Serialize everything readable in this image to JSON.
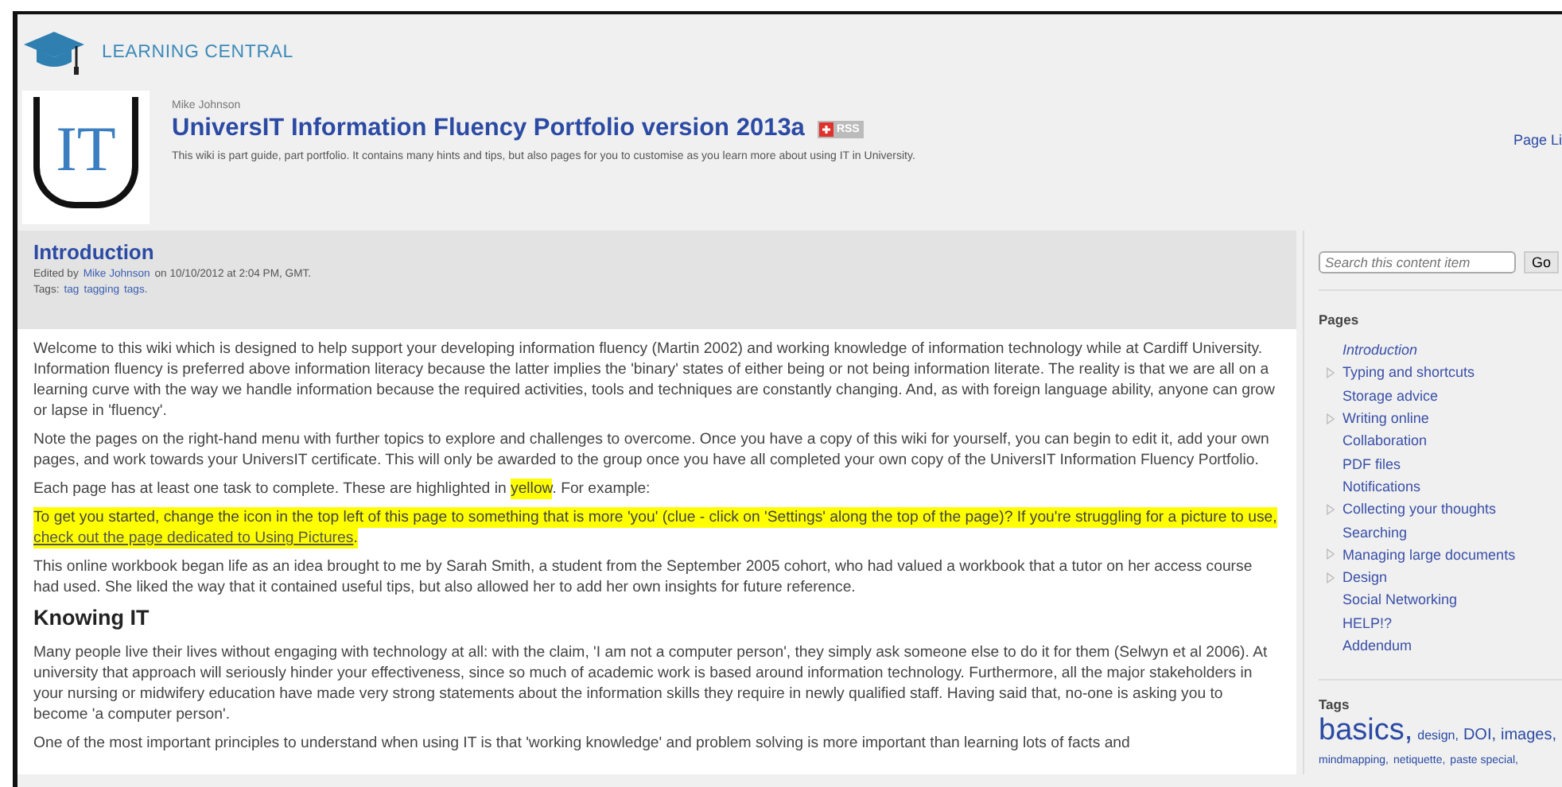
{
  "site": {
    "name": "LEARNING CENTRAL"
  },
  "header": {
    "logo_text": "IT",
    "author": "Mike Johnson",
    "title": "UniversIT Information Fluency Portfolio version 2013a",
    "badge": "RSS",
    "description": "This wiki is part guide, part portfolio. It contains many hints and tips, but also pages for you to customise as you learn more about using IT in University.",
    "page_link": "Page Li"
  },
  "article": {
    "title": "Introduction",
    "edited_prefix": "Edited by",
    "edited_by": "Mike Johnson",
    "edited_suffix": "on 10/10/2012 at 2:04 PM, GMT.",
    "tags_label": "Tags:",
    "tags": [
      "tag",
      "tagging",
      "tags."
    ],
    "blocks": [
      {
        "kind": "para",
        "text": "Welcome to this wiki which is designed to help support your developing information fluency (Martin 2002) and working knowledge of information technology while at Cardiff University. Information fluency is preferred above information literacy because the latter implies the 'binary' states of either being or not being information literate. The reality is that we are all on a learning curve with the way we handle information because the required activities, tools and techniques are constantly changing. And, as with foreign language ability, anyone can grow or lapse in 'fluency'."
      },
      {
        "kind": "para",
        "text": "Note the pages on the right-hand menu with further topics to explore and challenges to overcome. Once you have a copy of this wiki for yourself, you can begin to edit it, add your own pages, and work towards your UniversIT certificate. This will only be awarded to the group once you have all completed your own copy of the UniversIT Information Fluency Portfolio."
      },
      {
        "kind": "mark",
        "before": "Each page has at least one task to complete. These are highlighted in ",
        "marked": "yellow",
        "after": ". For example:"
      },
      {
        "kind": "task",
        "text": "To get you started, change the icon in the top left of this page to something that is more 'you' (clue - click on 'Settings' along the top of the page)? If you're struggling for a picture to use, ",
        "link": "check out the page dedicated to Using Pictures",
        "after": "."
      },
      {
        "kind": "para",
        "text": "This online workbook began life as an idea brought to me by Sarah Smith, a student from the September 2005 cohort, who had valued a workbook that a tutor on her access course had used. She liked the way that it contained useful tips, but also allowed her to add her own insights for future reference."
      },
      {
        "kind": "heading",
        "text": "Knowing IT"
      },
      {
        "kind": "para",
        "text": "Many people live their lives without engaging with technology at all: with the claim, 'I am not a computer person', they simply ask someone else to do it for them (Selwyn et al 2006). At university that approach will seriously hinder your effectiveness, since so much of academic work is based around information technology. Furthermore, all the major stakeholders in your nursing or midwifery education have made very strong statements about the information skills they require in newly qualified staff. Having said that, no-one is asking you to become 'a computer person'."
      },
      {
        "kind": "para",
        "text": "One of the most important principles to understand when using IT is that 'working knowledge' and problem solving is more important than learning lots of facts and"
      }
    ]
  },
  "sidebar": {
    "search": {
      "placeholder": "Search this content item",
      "button": "Go"
    },
    "pages_title": "Pages",
    "pages": [
      {
        "label": "Introduction",
        "kind": "leaf",
        "selected": true
      },
      {
        "label": "Typing and shortcuts",
        "kind": "branch",
        "selected": false
      },
      {
        "label": "Storage advice",
        "kind": "leaf",
        "selected": false
      },
      {
        "label": "Writing online",
        "kind": "branch",
        "selected": false
      },
      {
        "label": "Collaboration",
        "kind": "leaf",
        "selected": false
      },
      {
        "label": "PDF files",
        "kind": "leaf",
        "selected": false
      },
      {
        "label": "Notifications",
        "kind": "leaf",
        "selected": false
      },
      {
        "label": "Collecting your thoughts",
        "kind": "branch",
        "selected": false
      },
      {
        "label": "Searching",
        "kind": "leaf",
        "selected": false
      },
      {
        "label": "Managing large documents",
        "kind": "branch",
        "selected": false
      },
      {
        "label": "Design",
        "kind": "branch",
        "selected": false
      },
      {
        "label": "Social Networking",
        "kind": "leaf",
        "selected": false
      },
      {
        "label": "HELP!?",
        "kind": "leaf",
        "selected": false
      },
      {
        "label": "Addendum",
        "kind": "leaf",
        "selected": false
      }
    ],
    "tags_title": "Tags",
    "tags": [
      {
        "label": "basics,",
        "kind": "large"
      },
      {
        "label": "design,",
        "kind": "small"
      },
      {
        "label": "DOI,",
        "kind": "medium"
      },
      {
        "label": "images,",
        "kind": "medium"
      },
      {
        "label": "mindmapping,",
        "kind": "tiny"
      },
      {
        "label": "netiquette,",
        "kind": "tiny"
      },
      {
        "label": "paste special,",
        "kind": "tiny"
      }
    ]
  }
}
